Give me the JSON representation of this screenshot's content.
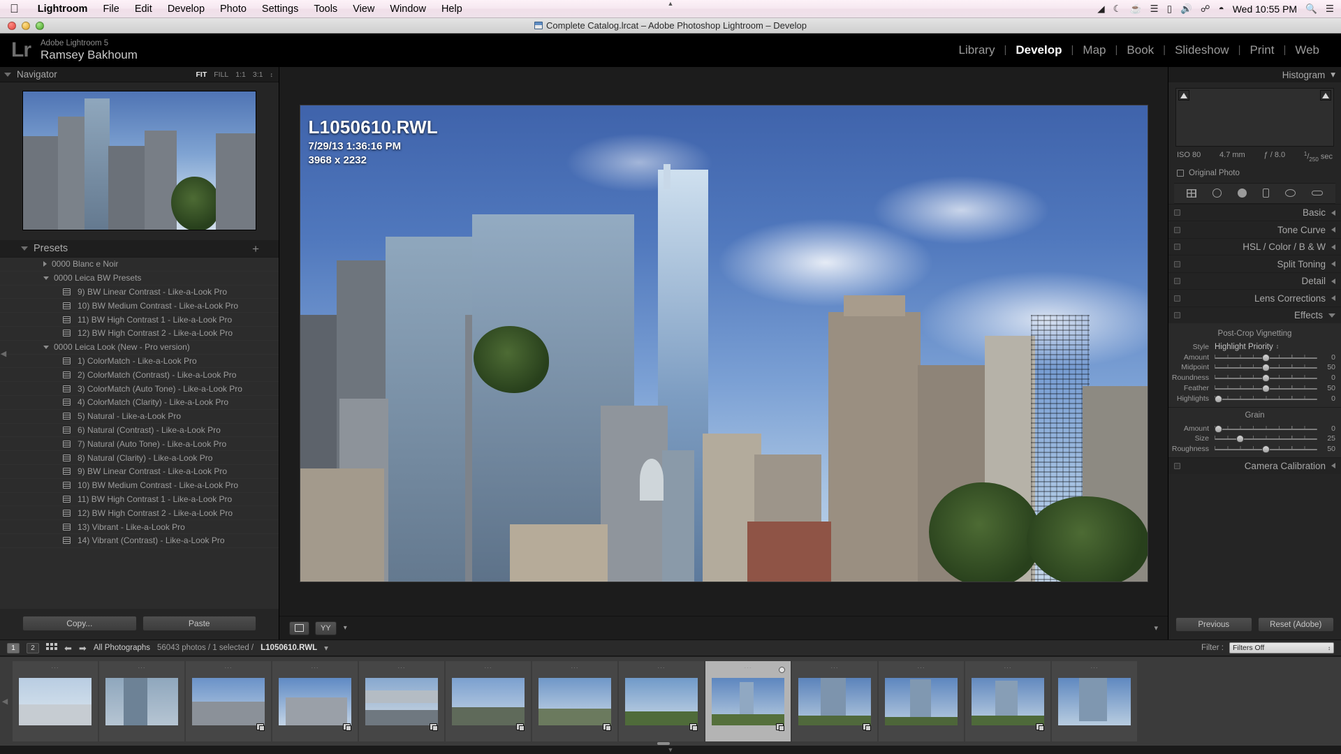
{
  "macbar": {
    "apple_icon": "apple-logo-icon",
    "items": [
      {
        "label": "Lightroom",
        "bold": true
      },
      {
        "label": "File",
        "bold": false
      },
      {
        "label": "Edit",
        "bold": false
      },
      {
        "label": "Develop",
        "bold": false
      },
      {
        "label": "Photo",
        "bold": false
      },
      {
        "label": "Settings",
        "bold": false
      },
      {
        "label": "Tools",
        "bold": false
      },
      {
        "label": "View",
        "bold": false
      },
      {
        "label": "Window",
        "bold": false
      },
      {
        "label": "Help",
        "bold": false
      }
    ],
    "status_icons": [
      "dropbox-icon",
      "moon-icon",
      "coffee-icon",
      "equalizer-icon",
      "display-icon",
      "volume-icon",
      "bluetooth-icon",
      "wifi-icon"
    ],
    "clock": "Wed 10:55 PM",
    "search_icon": "search-icon",
    "menu_icon": "menu-list-icon"
  },
  "window": {
    "title": "Complete Catalog.lrcat – Adobe Photoshop Lightroom – Develop",
    "catalog_icon": "catalog-file-icon"
  },
  "identity": {
    "logo": "Lr",
    "app_name": "Adobe Lightroom 5",
    "user_name": "Ramsey Bakhoum"
  },
  "modules": [
    {
      "label": "Library",
      "active": false
    },
    {
      "label": "Develop",
      "active": true
    },
    {
      "label": "Map",
      "active": false
    },
    {
      "label": "Book",
      "active": false
    },
    {
      "label": "Slideshow",
      "active": false
    },
    {
      "label": "Print",
      "active": false
    },
    {
      "label": "Web",
      "active": false
    }
  ],
  "navigator": {
    "title": "Navigator",
    "modes": [
      {
        "label": "FIT",
        "active": true
      },
      {
        "label": "FILL",
        "active": false
      },
      {
        "label": "1:1",
        "active": false
      },
      {
        "label": "3:1",
        "active": false
      }
    ],
    "caret": "↕"
  },
  "presets": {
    "title": "Presets",
    "add_label": "+",
    "rows": [
      {
        "type": "group",
        "expanded": false,
        "label": "0000 Blanc e Noir"
      },
      {
        "type": "group",
        "expanded": true,
        "label": "0000 Leica BW Presets"
      },
      {
        "type": "item",
        "label": "9)  BW Linear Contrast - Like-a-Look Pro"
      },
      {
        "type": "item",
        "label": "10) BW Medium Contrast - Like-a-Look Pro"
      },
      {
        "type": "item",
        "label": "11) BW High Contrast 1 - Like-a-Look Pro"
      },
      {
        "type": "item",
        "label": "12) BW High Contrast 2 - Like-a-Look Pro"
      },
      {
        "type": "group",
        "expanded": true,
        "label": "0000 Leica Look (New - Pro version)"
      },
      {
        "type": "item",
        "label": "1)  ColorMatch - Like-a-Look Pro"
      },
      {
        "type": "item",
        "label": "2)  ColorMatch (Contrast) - Like-a-Look Pro"
      },
      {
        "type": "item",
        "label": "3)  ColorMatch (Auto Tone) - Like-a-Look Pro"
      },
      {
        "type": "item",
        "label": "4)  ColorMatch (Clarity) - Like-a-Look Pro"
      },
      {
        "type": "item",
        "label": "5)  Natural - Like-a-Look Pro"
      },
      {
        "type": "item",
        "label": "6)  Natural (Contrast) - Like-a-Look Pro"
      },
      {
        "type": "item",
        "label": "7)  Natural (Auto Tone) - Like-a-Look Pro"
      },
      {
        "type": "item",
        "label": "8)  Natural (Clarity) - Like-a-Look Pro"
      },
      {
        "type": "item",
        "label": "9)  BW Linear Contrast - Like-a-Look Pro"
      },
      {
        "type": "item",
        "label": "10) BW Medium Contrast - Like-a-Look Pro"
      },
      {
        "type": "item",
        "label": "11) BW High Contrast 1 - Like-a-Look Pro"
      },
      {
        "type": "item",
        "label": "12) BW High Contrast 2 - Like-a-Look Pro"
      },
      {
        "type": "item",
        "label": "13) Vibrant - Like-a-Look Pro"
      },
      {
        "type": "item",
        "label": "14) Vibrant (Contrast) - Like-a-Look Pro"
      }
    ],
    "copy_label": "Copy...",
    "paste_label": "Paste"
  },
  "photo": {
    "filename": "L1050610.RWL",
    "datetime": "7/29/13 1:36:16 PM",
    "dimensions": "3968 x 2232"
  },
  "toolbar": {
    "loupe_icon": "loupe-view-icon",
    "compare_label": "YY",
    "caret": "▾",
    "panel_caret": "▾"
  },
  "histogram": {
    "title": "Histogram",
    "caret": "▾",
    "iso": "ISO 80",
    "focal_length": "4.7 mm",
    "aperture": "ƒ / 8.0",
    "shutter_num": "1",
    "shutter_den": "250",
    "shutter_unit": "sec",
    "original_photo_label": "Original Photo",
    "clip_shadow_icon": "shadow-clipping-icon",
    "clip_highlight_icon": "highlight-clipping-icon"
  },
  "tools": [
    {
      "icon": "crop-overlay-icon"
    },
    {
      "icon": "spot-removal-icon"
    },
    {
      "icon": "red-eye-correction-icon"
    },
    {
      "icon": "graduated-filter-icon"
    },
    {
      "icon": "radial-filter-icon"
    },
    {
      "icon": "adjustment-brush-icon"
    }
  ],
  "sections": [
    {
      "title": "Basic",
      "expanded": false
    },
    {
      "title": "Tone Curve",
      "expanded": false
    },
    {
      "title": "HSL / Color / B & W",
      "expanded": false
    },
    {
      "title": "Split Toning",
      "expanded": false
    },
    {
      "title": "Detail",
      "expanded": false
    },
    {
      "title": "Lens Corrections",
      "expanded": false
    },
    {
      "title": "Effects",
      "expanded": true
    }
  ],
  "effects": {
    "vignette_title": "Post-Crop Vignetting",
    "style_label": "Style",
    "style_value": "Highlight Priority",
    "sliders": [
      {
        "label": "Amount",
        "value": "0",
        "pos": 50
      },
      {
        "label": "Midpoint",
        "value": "50",
        "pos": 50
      },
      {
        "label": "Roundness",
        "value": "0",
        "pos": 50
      },
      {
        "label": "Feather",
        "value": "50",
        "pos": 50
      },
      {
        "label": "Highlights",
        "value": "0",
        "pos": 4
      }
    ],
    "grain_title": "Grain",
    "grain_sliders": [
      {
        "label": "Amount",
        "value": "0",
        "pos": 4
      },
      {
        "label": "Size",
        "value": "25",
        "pos": 25
      },
      {
        "label": "Roughness",
        "value": "50",
        "pos": 50
      }
    ]
  },
  "camera_calibration": {
    "title": "Camera Calibration"
  },
  "right_buttons": {
    "previous_label": "Previous",
    "reset_label": "Reset (Adobe)"
  },
  "filmstrip_bar": {
    "screen1": "1",
    "screen2": "2",
    "grid_icon": "grid-view-icon",
    "back_icon": "nav-back-icon",
    "forward_icon": "nav-forward-icon",
    "source_label": "All Photographs",
    "count_text": "56043 photos / 1 selected /",
    "selected_file": "L1050610.RWL",
    "file_caret": "▾",
    "filter_label": "Filter :",
    "filter_value": "Filters Off",
    "filter_caret": "↕"
  },
  "filmstrip": {
    "thumbs": [
      {
        "selected": false,
        "badge": false,
        "kind": "sky"
      },
      {
        "selected": false,
        "badge": false,
        "kind": "glass"
      },
      {
        "selected": false,
        "badge": true,
        "kind": "bldg"
      },
      {
        "selected": false,
        "badge": true,
        "kind": "bldg2"
      },
      {
        "selected": false,
        "badge": true,
        "kind": "under"
      },
      {
        "selected": false,
        "badge": true,
        "kind": "road"
      },
      {
        "selected": false,
        "badge": true,
        "kind": "road2"
      },
      {
        "selected": false,
        "badge": true,
        "kind": "park"
      },
      {
        "selected": true,
        "badge": true,
        "kind": "tower",
        "circle": true
      },
      {
        "selected": false,
        "badge": true,
        "kind": "tower2"
      },
      {
        "selected": false,
        "badge": false,
        "kind": "tower3"
      },
      {
        "selected": false,
        "badge": true,
        "kind": "tower4"
      },
      {
        "selected": false,
        "badge": false,
        "kind": "tower5"
      }
    ]
  }
}
